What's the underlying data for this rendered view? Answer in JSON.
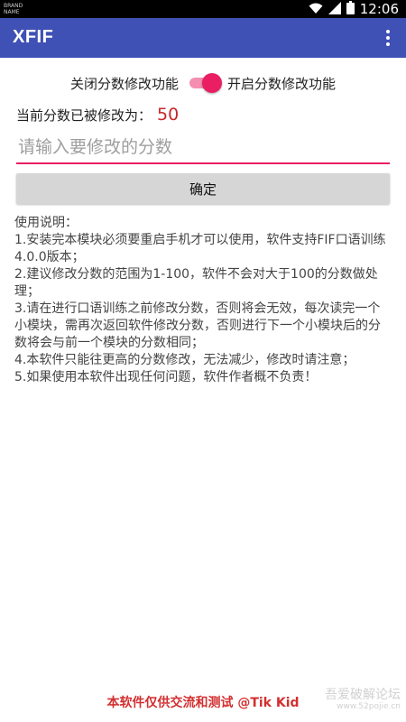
{
  "status_bar": {
    "left_text": "BRAND NAME",
    "time": "12:06"
  },
  "app_bar": {
    "title": "XFIF"
  },
  "toggle": {
    "off_label": "关闭分数修改功能",
    "on_label": "开启分数修改功能",
    "state": "on"
  },
  "score": {
    "label": "当前分数已被修改为：",
    "value": "50"
  },
  "input": {
    "placeholder": "请输入要修改的分数",
    "value": ""
  },
  "confirm_button": {
    "label": "确定"
  },
  "instructions": {
    "title": "使用说明：",
    "items": [
      "1.安装完本模块必须要重启手机才可以使用，软件支持FIF口语训练4.0.0版本；",
      "2.建议修改分数的范围为1-100，软件不会对大于100的分数做处理；",
      "3.请在进行口语训练之前修改分数，否则将会无效，每次读完一个小模块，需再次返回软件修改分数，否则进行下一个小模块后的分数将会与前一个模块的分数相同；",
      "4.本软件只能往更高的分数修改，无法减少，修改时请注意；",
      "5.如果使用本软件出现任何问题，软件作者概不负责！"
    ]
  },
  "footer": {
    "text": "本软件仅供交流和测试 @Tik Kid"
  },
  "watermark": {
    "main": "吾爱破解论坛",
    "sub": "www.52pojie.cn"
  },
  "colors": {
    "app_bar": "#3f51b5",
    "accent": "#e91e63",
    "score_value": "#c62828",
    "footer_text": "#d32f2f"
  }
}
